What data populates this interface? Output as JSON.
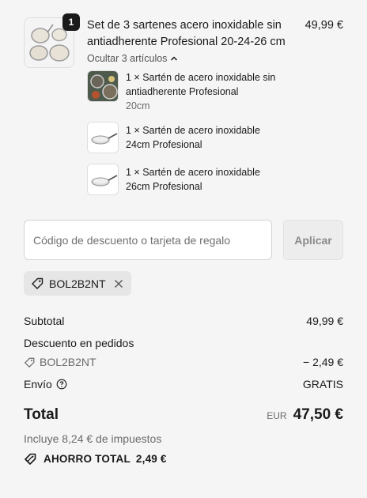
{
  "product": {
    "quantity": "1",
    "title": "Set de 3 sartenes acero inoxidable sin antiadherente Profesional 20-24-26 cm",
    "price": "49,99 €",
    "collapse_label": "Ocultar 3 artículos",
    "items": [
      {
        "label": "1 × Sartén de acero inoxidable sin antiadherente Profesional",
        "variant": "20cm",
        "thumb_icon": "pan-set-photo"
      },
      {
        "label": "1 × Sartén de acero inoxidable 24cm Profesional",
        "thumb_icon": "pan-icon"
      },
      {
        "label": "1 × Sartén de acero inoxidable 26cm Profesional",
        "thumb_icon": "pan-icon"
      }
    ]
  },
  "discount": {
    "placeholder": "Código de descuento o tarjeta de regalo",
    "value": "",
    "apply_label": "Aplicar",
    "applied_code": "BOL2B2NT"
  },
  "summary": {
    "subtotal_label": "Subtotal",
    "subtotal_value": "49,99 €",
    "order_discount_label": "Descuento en pedidos",
    "discount_code": "BOL2B2NT",
    "discount_value": "− 2,49 €",
    "shipping_label": "Envío",
    "shipping_value": "GRATIS",
    "total_label": "Total",
    "currency": "EUR",
    "total_value": "47,50 €",
    "tax_note": "Incluye 8,24 € de impuestos",
    "savings_label": "AHORRO TOTAL",
    "savings_value": "2,49 €"
  },
  "colors": {
    "background": "#f5f5f5",
    "text": "#1a1a1a",
    "muted": "#6b6b6b",
    "badge": "#1a1a1a"
  }
}
